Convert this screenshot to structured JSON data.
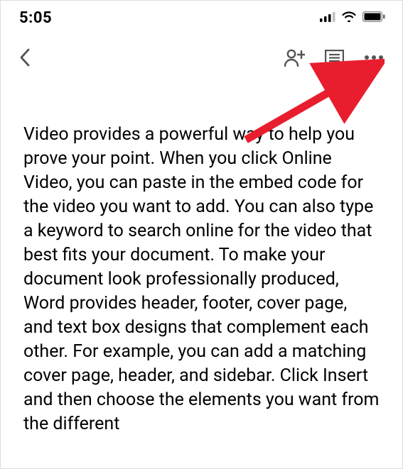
{
  "status_bar": {
    "time": "5:05"
  },
  "document": {
    "body": "Video provides a powerful way to help you prove your point. When you click Online Video, you can paste in the embed code for the video you want to add. You can also type a keyword to search online for the video that best fits your document. To make your document look professionally produced, Word provides header, footer, cover page, and text box designs that complement each other. For example, you can add a matching cover page, header, and sidebar. Click Insert and then choose the elements you want from the different"
  }
}
